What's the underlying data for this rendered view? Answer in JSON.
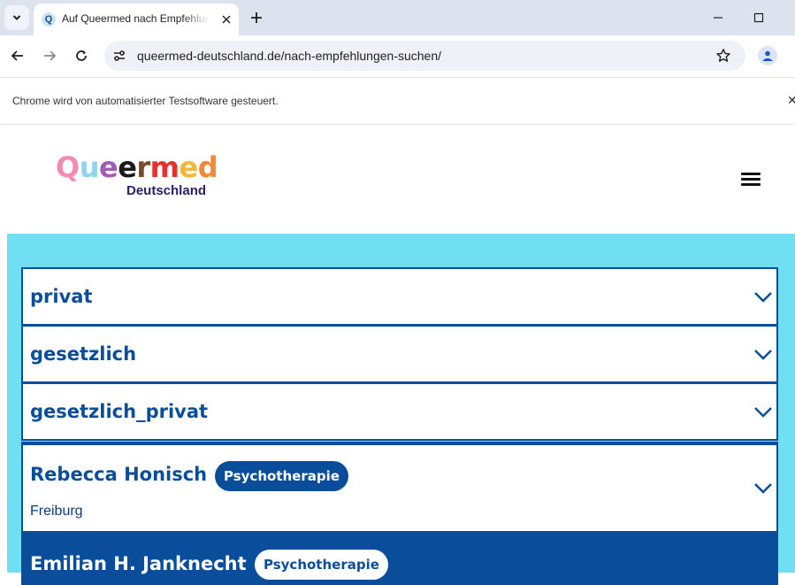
{
  "browser": {
    "tab_title": "Auf Queermed nach Empfehlungen suchen",
    "favicon_letter": "Q",
    "url": "queermed-deutschland.de/nach-empfehlungen-suchen/",
    "automation_notice": "Chrome wird von automatisierter Testsoftware gesteuert."
  },
  "header": {
    "logo_letters": [
      {
        "ch": "Q",
        "color": "#f28bb2"
      },
      {
        "ch": "u",
        "color": "#8fd3f0"
      },
      {
        "ch": "e",
        "color": "#a25bb8"
      },
      {
        "ch": "e",
        "color": "#1a1a1a"
      },
      {
        "ch": "r",
        "color": "#7a4a2a"
      },
      {
        "ch": "m",
        "color": "#e6312a"
      },
      {
        "ch": "e",
        "color": "#f4b63a"
      },
      {
        "ch": "d",
        "color": "#f08a3a"
      }
    ],
    "logo_subtitle": "Deutschland",
    "menu_icon": "hamburger-icon"
  },
  "accordions": [
    {
      "title": "privat"
    },
    {
      "title": "gesetzlich"
    },
    {
      "title": "gesetzlich_privat"
    }
  ],
  "results": [
    {
      "name": "Rebecca Honisch",
      "badge": "Psychotherapie",
      "city": "Freiburg"
    },
    {
      "name": "Emilian H. Janknecht",
      "badge": "Psychotherapie"
    }
  ],
  "colors": {
    "primary": "#0a4e9b",
    "page_background": "#71dff2"
  }
}
